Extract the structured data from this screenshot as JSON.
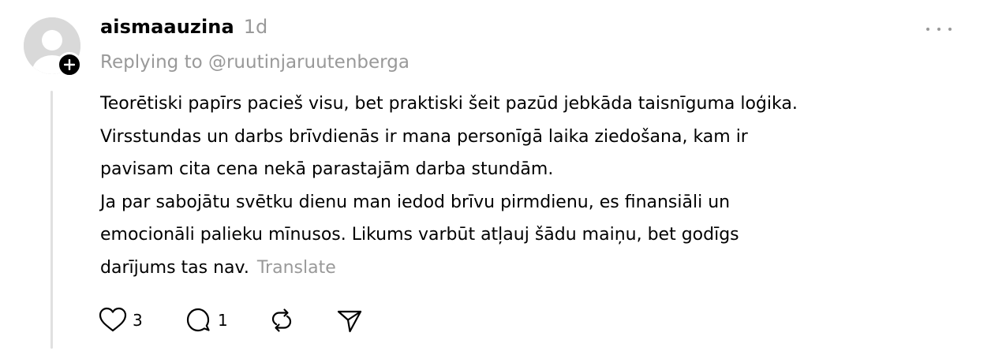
{
  "post": {
    "username": "aismaauzina",
    "timestamp": "1d",
    "replying_to": "Replying to @ruutinjaruutenberga",
    "body_lines": [
      "Teorētiski papīrs pacieš visu, bet praktiski šeit pazūd jebkāda taisnīguma loģika.",
      "Virsstundas un darbs brīvdienās ir mana personīgā laika ziedošana, kam ir",
      "pavisam cita cena nekā parastajām darba stundām.",
      "Ja par sabojātu svētku dienu man iedod brīvu pirmdienu, es finansiāli un",
      "emocionāli palieku mīnusos. Likums varbūt atļauj šādu maiņu, bet godīgs",
      "darījums tas nav."
    ],
    "translate_label": "Translate",
    "more_icon": "more-horizontal-icon",
    "avatar_icon": "default-avatar-icon",
    "follow_icon": "plus-icon"
  },
  "actions": {
    "like": {
      "icon": "heart-icon",
      "count": "3"
    },
    "reply": {
      "icon": "comment-icon",
      "count": "1"
    },
    "repost": {
      "icon": "repost-icon"
    },
    "share": {
      "icon": "send-icon"
    }
  },
  "colors": {
    "text": "#000000",
    "muted": "#999999",
    "avatar_bg": "#d9d9d9",
    "thread_line": "#e0e0e0"
  }
}
